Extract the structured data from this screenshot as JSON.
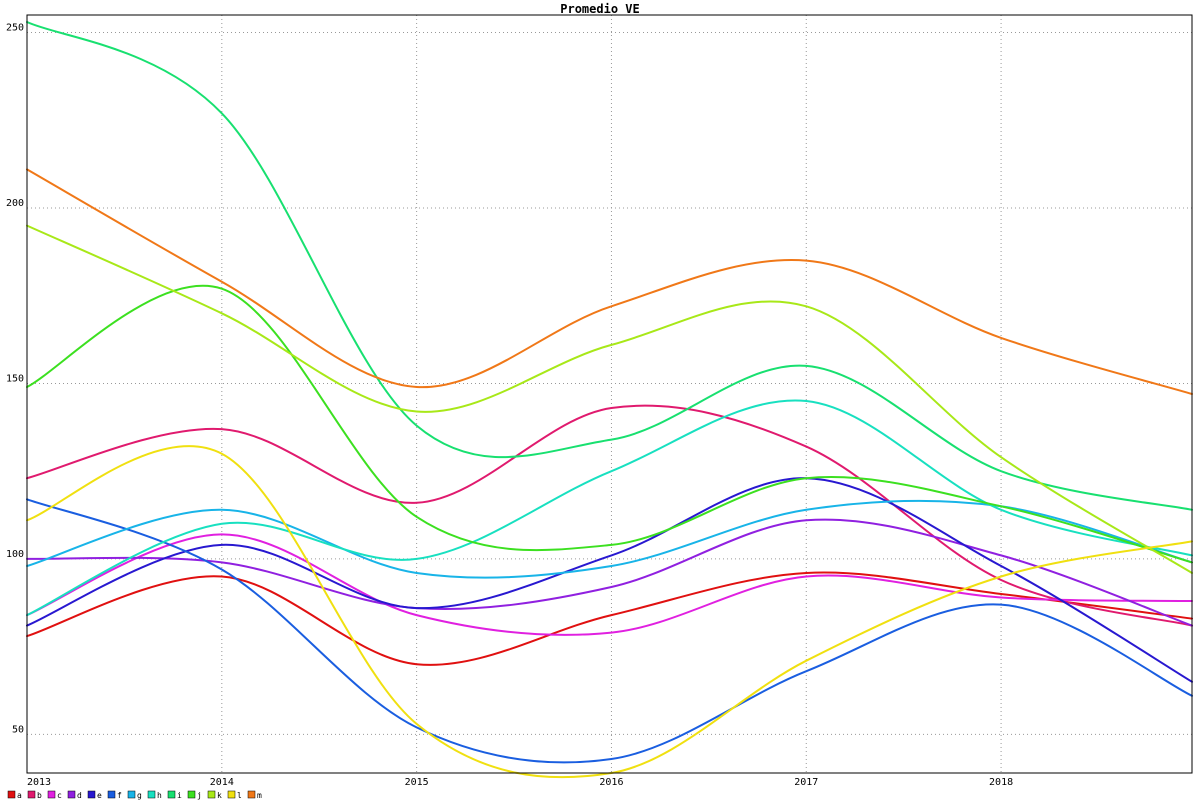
{
  "chart_data": {
    "type": "line",
    "title": "Promedio VE",
    "xlabel": "",
    "ylabel": "",
    "xlim": [
      2013,
      2018.98
    ],
    "ylim": [
      39,
      255
    ],
    "x_ticks": [
      2013,
      2014,
      2015,
      2016,
      2017,
      2018
    ],
    "y_ticks": [
      50,
      100,
      150,
      200,
      250
    ],
    "grid": true,
    "smooth": true,
    "legend_position": "bottom-left",
    "x": [
      2013,
      2014,
      2015,
      2016,
      2017,
      2018,
      2018.98
    ],
    "series": [
      {
        "name": "a",
        "color": "#e01010",
        "values": [
          78,
          95,
          70,
          84,
          96,
          90,
          83
        ]
      },
      {
        "name": "b",
        "color": "#e01a6e",
        "values": [
          123,
          137,
          116,
          143,
          132,
          94,
          81
        ]
      },
      {
        "name": "c",
        "color": "#e020e0",
        "values": [
          84,
          107,
          84,
          79,
          95,
          89,
          88
        ]
      },
      {
        "name": "d",
        "color": "#9020e0",
        "values": [
          100,
          99,
          86,
          92,
          111,
          101,
          81
        ]
      },
      {
        "name": "e",
        "color": "#2818d0",
        "values": [
          81,
          104,
          86,
          101,
          123,
          98,
          65
        ]
      },
      {
        "name": "f",
        "color": "#1a5ee0",
        "values": [
          117,
          97,
          52,
          43,
          68,
          87,
          61
        ]
      },
      {
        "name": "g",
        "color": "#18b4e8",
        "values": [
          98,
          114,
          96,
          98,
          114,
          115,
          99
        ]
      },
      {
        "name": "h",
        "color": "#18e0c0",
        "values": [
          84,
          110,
          100,
          125,
          145,
          114,
          101
        ]
      },
      {
        "name": "i",
        "color": "#18e070",
        "values": [
          253,
          227,
          138,
          134,
          155,
          125,
          114
        ]
      },
      {
        "name": "j",
        "color": "#3ce020",
        "values": [
          149,
          177,
          112,
          104,
          123,
          115,
          99
        ]
      },
      {
        "name": "k",
        "color": "#a8e818",
        "values": [
          195,
          170,
          142,
          161,
          172,
          129,
          96
        ]
      },
      {
        "name": "l",
        "color": "#f0e010",
        "values": [
          111,
          130,
          53,
          39,
          71,
          95,
          105
        ]
      },
      {
        "name": "m",
        "color": "#f07818",
        "values": [
          211,
          179,
          149,
          172,
          185,
          163,
          147
        ]
      }
    ]
  }
}
